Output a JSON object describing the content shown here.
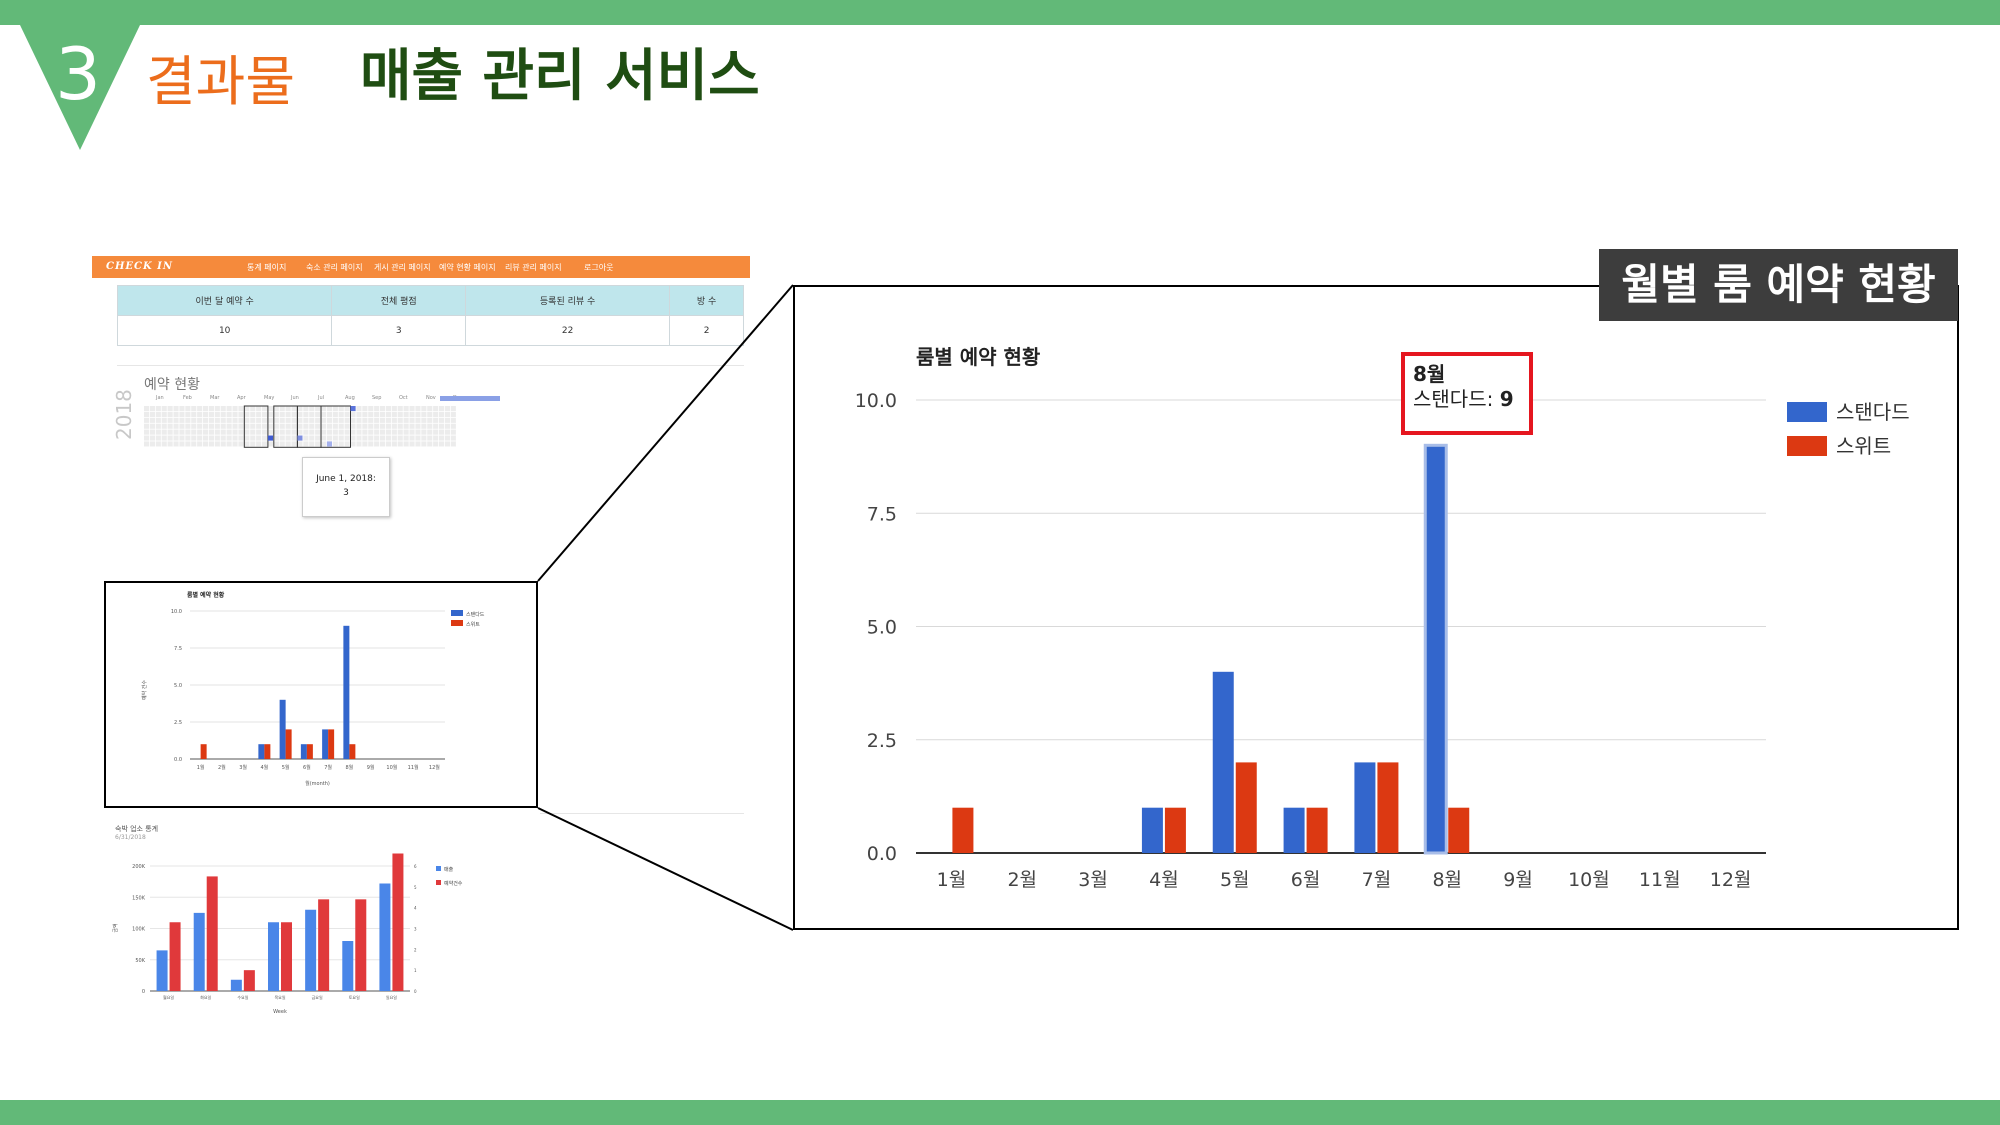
{
  "header": {
    "section_number": "3",
    "section_label": "결과물",
    "title": "매출 관리 서비스"
  },
  "overlay_label": "월별 룸 예약 현황",
  "dashboard": {
    "logo": "CHECK IN",
    "nav_items": [
      "통계 페이지",
      "숙소 관리 페이지",
      "게시 관리 페이지",
      "예약 현황 페이지",
      "리뷰 관리 페이지",
      "로그아웃"
    ],
    "stats": {
      "headers": [
        "이번 달 예약 수",
        "전체 평점",
        "등록된 리뷰 수",
        "방 수"
      ],
      "values": [
        "10",
        "3",
        "22",
        "2"
      ]
    },
    "calendar": {
      "title": "예약 현황",
      "year": "2018",
      "months": [
        "Jan",
        "Feb",
        "Mar",
        "Apr",
        "May",
        "Jun",
        "Jul",
        "Aug",
        "Sep",
        "Oct",
        "Nov",
        "Dec"
      ],
      "tooltip_date": "June 1, 2018:",
      "tooltip_value": "3"
    },
    "revenue_chart": {
      "title": "숙박 업소 통계",
      "subtitle": "6/31/2018",
      "xlabel": "Week",
      "ylabel": "금액",
      "legend": [
        "매출",
        "예약건수"
      ],
      "categories": [
        "월요일",
        "화요일",
        "수요일",
        "목요일",
        "금요일",
        "토요일",
        "일요일"
      ],
      "y_ticks": [
        "0",
        "50K",
        "100K",
        "150K",
        "200K"
      ],
      "y2_ticks": [
        "0",
        "1",
        "2",
        "3",
        "4",
        "5",
        "6"
      ],
      "sales": [
        65000,
        125000,
        18000,
        110000,
        130000,
        80000,
        172000
      ],
      "bookings": [
        3.3,
        5.5,
        1.0,
        3.3,
        4.4,
        4.4,
        6.6
      ],
      "colors": [
        "#4a86e8",
        "#e0393b"
      ]
    }
  },
  "chart_data": {
    "type": "bar",
    "title": "룸별 예약 현황",
    "categories": [
      "1월",
      "2월",
      "3월",
      "4월",
      "5월",
      "6월",
      "7월",
      "8월",
      "9월",
      "10월",
      "11월",
      "12월"
    ],
    "series": [
      {
        "name": "스탠다드",
        "values": [
          0,
          0,
          0,
          1,
          4,
          1,
          2,
          9,
          0,
          0,
          0,
          0
        ],
        "color": "#3366cc"
      },
      {
        "name": "스위트",
        "values": [
          1,
          0,
          0,
          1,
          2,
          1,
          2,
          1,
          0,
          0,
          0,
          0
        ],
        "color": "#dc3912"
      }
    ],
    "ylim": [
      0,
      10
    ],
    "y_ticks": [
      "0.0",
      "2.5",
      "5.0",
      "7.5",
      "10.0"
    ],
    "legend_position": "right",
    "grid": true,
    "small_xlabel": "월(month)",
    "small_ylabel": "예약 건수",
    "tooltip": {
      "month": "8월",
      "series": "스탠다드",
      "value": "9"
    }
  }
}
